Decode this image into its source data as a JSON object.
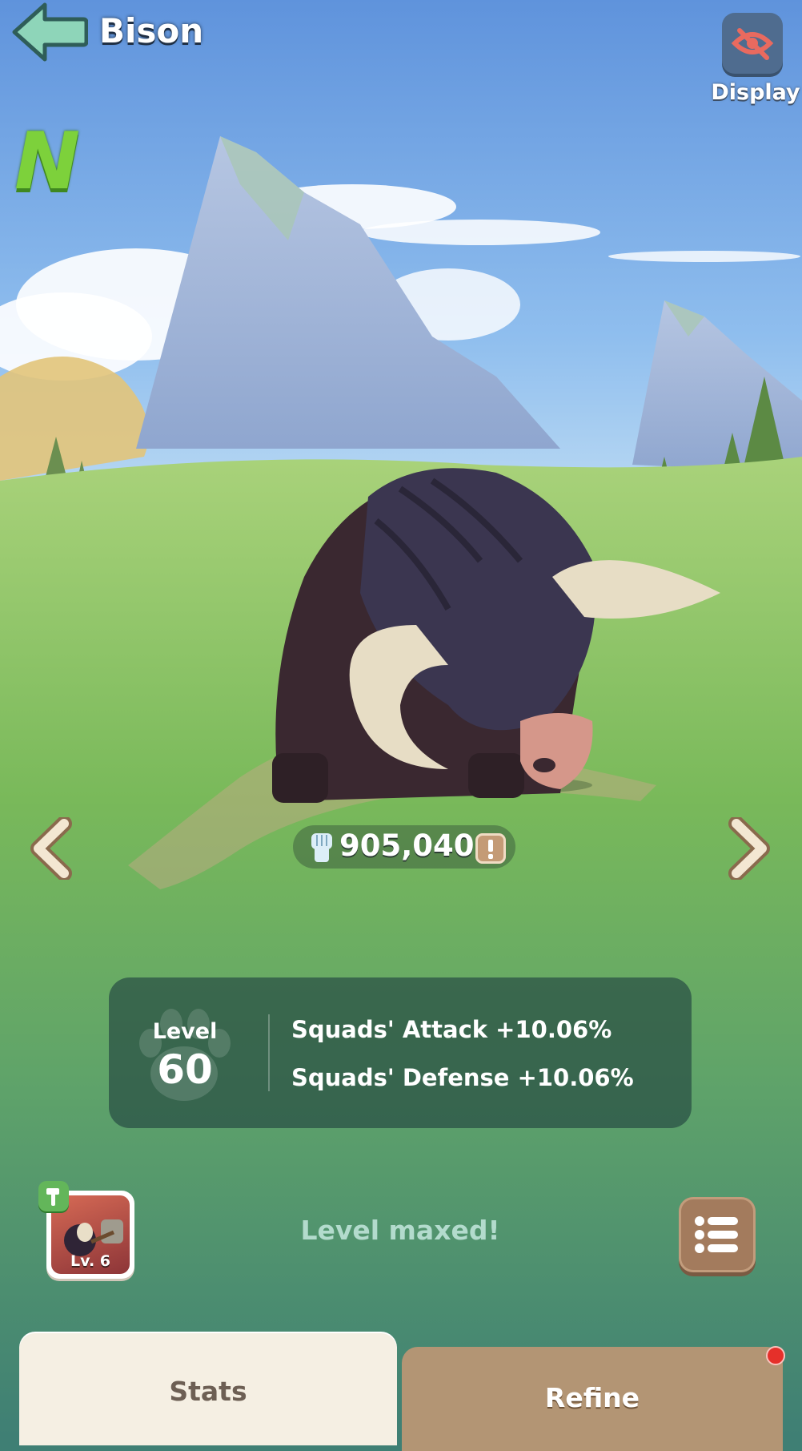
{
  "header": {
    "title": "Bison"
  },
  "display_button": {
    "label": "Display",
    "icon": "eye-slash-icon"
  },
  "rarity_badge": {
    "text": "N",
    "color": "#7dd13b"
  },
  "nav": {
    "prev_icon": "chevron-left-icon",
    "next_icon": "chevron-right-icon"
  },
  "power": {
    "icon": "fist-icon",
    "value": "905,040",
    "info_icon": "exclamation-icon"
  },
  "level_panel": {
    "label": "Level",
    "value": "60",
    "icon": "paw-icon",
    "bonuses": [
      "Squads' Attack +10.06%",
      "Squads' Defense +10.06%"
    ]
  },
  "skill": {
    "level_text": "Lv. 6",
    "badge_icon": "hammer-icon"
  },
  "status_text": "Level maxed!",
  "list_button_icon": "list-icon",
  "tabs": [
    {
      "label": "Stats",
      "active": true
    },
    {
      "label": "Refine",
      "active": false,
      "notification": true
    }
  ],
  "colors": {
    "sky": "#6f9fe0",
    "grass": "#7fbf5a",
    "panel_bg": "#3f7f74",
    "accent_green": "#7dd13b",
    "refine_tab": "#b39574",
    "stats_tab": "#f5efe3"
  }
}
